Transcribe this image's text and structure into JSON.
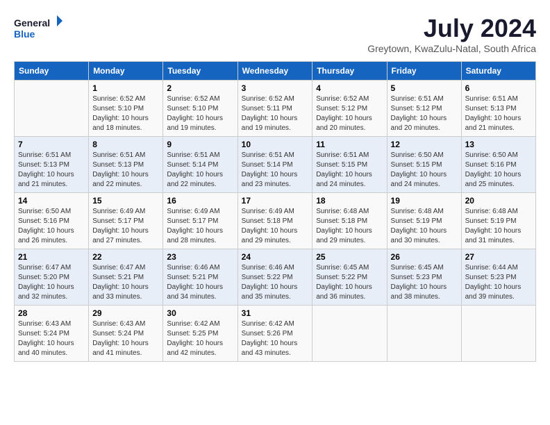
{
  "header": {
    "logo_line1": "General",
    "logo_line2": "Blue",
    "month_year": "July 2024",
    "location": "Greytown, KwaZulu-Natal, South Africa"
  },
  "days_of_week": [
    "Sunday",
    "Monday",
    "Tuesday",
    "Wednesday",
    "Thursday",
    "Friday",
    "Saturday"
  ],
  "weeks": [
    [
      {
        "day": "",
        "info": ""
      },
      {
        "day": "1",
        "info": "Sunrise: 6:52 AM\nSunset: 5:10 PM\nDaylight: 10 hours\nand 18 minutes."
      },
      {
        "day": "2",
        "info": "Sunrise: 6:52 AM\nSunset: 5:10 PM\nDaylight: 10 hours\nand 19 minutes."
      },
      {
        "day": "3",
        "info": "Sunrise: 6:52 AM\nSunset: 5:11 PM\nDaylight: 10 hours\nand 19 minutes."
      },
      {
        "day": "4",
        "info": "Sunrise: 6:52 AM\nSunset: 5:12 PM\nDaylight: 10 hours\nand 20 minutes."
      },
      {
        "day": "5",
        "info": "Sunrise: 6:51 AM\nSunset: 5:12 PM\nDaylight: 10 hours\nand 20 minutes."
      },
      {
        "day": "6",
        "info": "Sunrise: 6:51 AM\nSunset: 5:13 PM\nDaylight: 10 hours\nand 21 minutes."
      }
    ],
    [
      {
        "day": "7",
        "info": "Sunrise: 6:51 AM\nSunset: 5:13 PM\nDaylight: 10 hours\nand 21 minutes."
      },
      {
        "day": "8",
        "info": "Sunrise: 6:51 AM\nSunset: 5:13 PM\nDaylight: 10 hours\nand 22 minutes."
      },
      {
        "day": "9",
        "info": "Sunrise: 6:51 AM\nSunset: 5:14 PM\nDaylight: 10 hours\nand 22 minutes."
      },
      {
        "day": "10",
        "info": "Sunrise: 6:51 AM\nSunset: 5:14 PM\nDaylight: 10 hours\nand 23 minutes."
      },
      {
        "day": "11",
        "info": "Sunrise: 6:51 AM\nSunset: 5:15 PM\nDaylight: 10 hours\nand 24 minutes."
      },
      {
        "day": "12",
        "info": "Sunrise: 6:50 AM\nSunset: 5:15 PM\nDaylight: 10 hours\nand 24 minutes."
      },
      {
        "day": "13",
        "info": "Sunrise: 6:50 AM\nSunset: 5:16 PM\nDaylight: 10 hours\nand 25 minutes."
      }
    ],
    [
      {
        "day": "14",
        "info": "Sunrise: 6:50 AM\nSunset: 5:16 PM\nDaylight: 10 hours\nand 26 minutes."
      },
      {
        "day": "15",
        "info": "Sunrise: 6:49 AM\nSunset: 5:17 PM\nDaylight: 10 hours\nand 27 minutes."
      },
      {
        "day": "16",
        "info": "Sunrise: 6:49 AM\nSunset: 5:17 PM\nDaylight: 10 hours\nand 28 minutes."
      },
      {
        "day": "17",
        "info": "Sunrise: 6:49 AM\nSunset: 5:18 PM\nDaylight: 10 hours\nand 29 minutes."
      },
      {
        "day": "18",
        "info": "Sunrise: 6:48 AM\nSunset: 5:18 PM\nDaylight: 10 hours\nand 29 minutes."
      },
      {
        "day": "19",
        "info": "Sunrise: 6:48 AM\nSunset: 5:19 PM\nDaylight: 10 hours\nand 30 minutes."
      },
      {
        "day": "20",
        "info": "Sunrise: 6:48 AM\nSunset: 5:19 PM\nDaylight: 10 hours\nand 31 minutes."
      }
    ],
    [
      {
        "day": "21",
        "info": "Sunrise: 6:47 AM\nSunset: 5:20 PM\nDaylight: 10 hours\nand 32 minutes."
      },
      {
        "day": "22",
        "info": "Sunrise: 6:47 AM\nSunset: 5:21 PM\nDaylight: 10 hours\nand 33 minutes."
      },
      {
        "day": "23",
        "info": "Sunrise: 6:46 AM\nSunset: 5:21 PM\nDaylight: 10 hours\nand 34 minutes."
      },
      {
        "day": "24",
        "info": "Sunrise: 6:46 AM\nSunset: 5:22 PM\nDaylight: 10 hours\nand 35 minutes."
      },
      {
        "day": "25",
        "info": "Sunrise: 6:45 AM\nSunset: 5:22 PM\nDaylight: 10 hours\nand 36 minutes."
      },
      {
        "day": "26",
        "info": "Sunrise: 6:45 AM\nSunset: 5:23 PM\nDaylight: 10 hours\nand 38 minutes."
      },
      {
        "day": "27",
        "info": "Sunrise: 6:44 AM\nSunset: 5:23 PM\nDaylight: 10 hours\nand 39 minutes."
      }
    ],
    [
      {
        "day": "28",
        "info": "Sunrise: 6:43 AM\nSunset: 5:24 PM\nDaylight: 10 hours\nand 40 minutes."
      },
      {
        "day": "29",
        "info": "Sunrise: 6:43 AM\nSunset: 5:24 PM\nDaylight: 10 hours\nand 41 minutes."
      },
      {
        "day": "30",
        "info": "Sunrise: 6:42 AM\nSunset: 5:25 PM\nDaylight: 10 hours\nand 42 minutes."
      },
      {
        "day": "31",
        "info": "Sunrise: 6:42 AM\nSunset: 5:26 PM\nDaylight: 10 hours\nand 43 minutes."
      },
      {
        "day": "",
        "info": ""
      },
      {
        "day": "",
        "info": ""
      },
      {
        "day": "",
        "info": ""
      }
    ]
  ]
}
